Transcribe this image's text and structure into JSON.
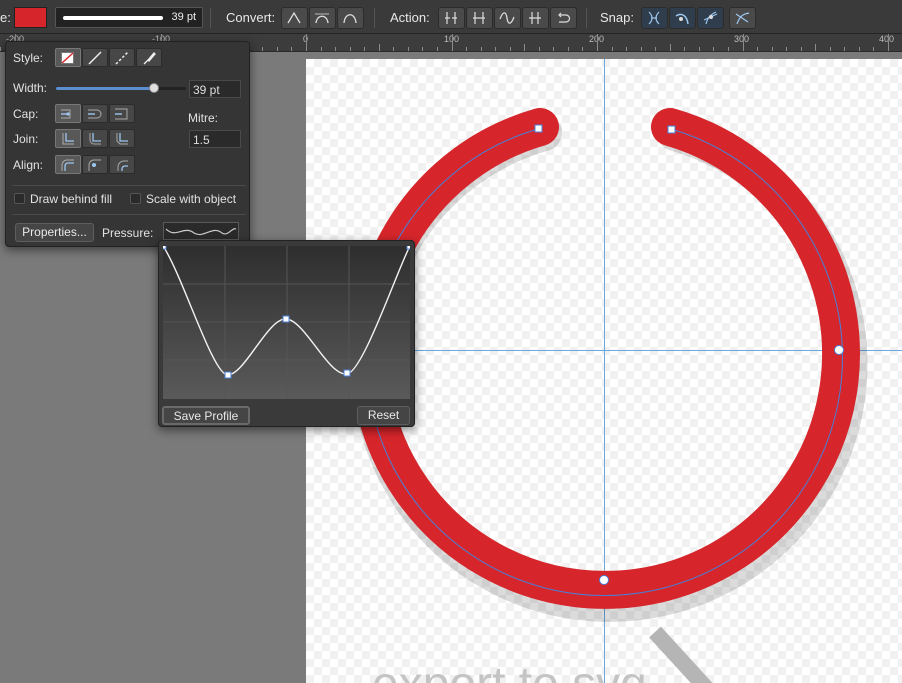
{
  "toolbar": {
    "stroke_label_fragment": "e:",
    "stroke_color": "#d6262b",
    "brush_size": "39 pt",
    "convert_label": "Convert:",
    "action_label": "Action:",
    "snap_label": "Snap:",
    "convert_buttons": [
      "sharp-node-icon",
      "smooth-node-icon",
      "smart-node-icon"
    ],
    "action_buttons": [
      "break-curve-icon",
      "join-curves-icon",
      "smooth-curve-icon",
      "reverse-curve-icon",
      "close-curve-icon"
    ],
    "snap_buttons": [
      "snap-nodes-icon",
      "snap-curve-icon",
      "snap-geometry-icon",
      "snap-intersection-icon"
    ]
  },
  "ruler": {
    "labels": [
      "-200",
      "-100",
      "0",
      "100",
      "200",
      "300",
      "400"
    ]
  },
  "stroke_panel": {
    "style_label": "Style:",
    "width_label": "Width:",
    "width_value": "39 pt",
    "width_fraction": 0.75,
    "cap_label": "Cap:",
    "join_label": "Join:",
    "align_label": "Align:",
    "mitre_label": "Mitre:",
    "mitre_value": "1.5",
    "draw_behind_fill_label": "Draw behind fill",
    "draw_behind_fill_checked": false,
    "scale_with_object_label": "Scale with object",
    "scale_with_object_checked": false,
    "properties_button": "Properties...",
    "pressure_label": "Pressure:"
  },
  "pressure_popup": {
    "save_profile_button": "Save Profile",
    "reset_button": "Reset"
  },
  "canvas": {
    "accent": "#d6262b",
    "guide_color": "#6aa8e0",
    "watermark_text": "export to svg"
  }
}
